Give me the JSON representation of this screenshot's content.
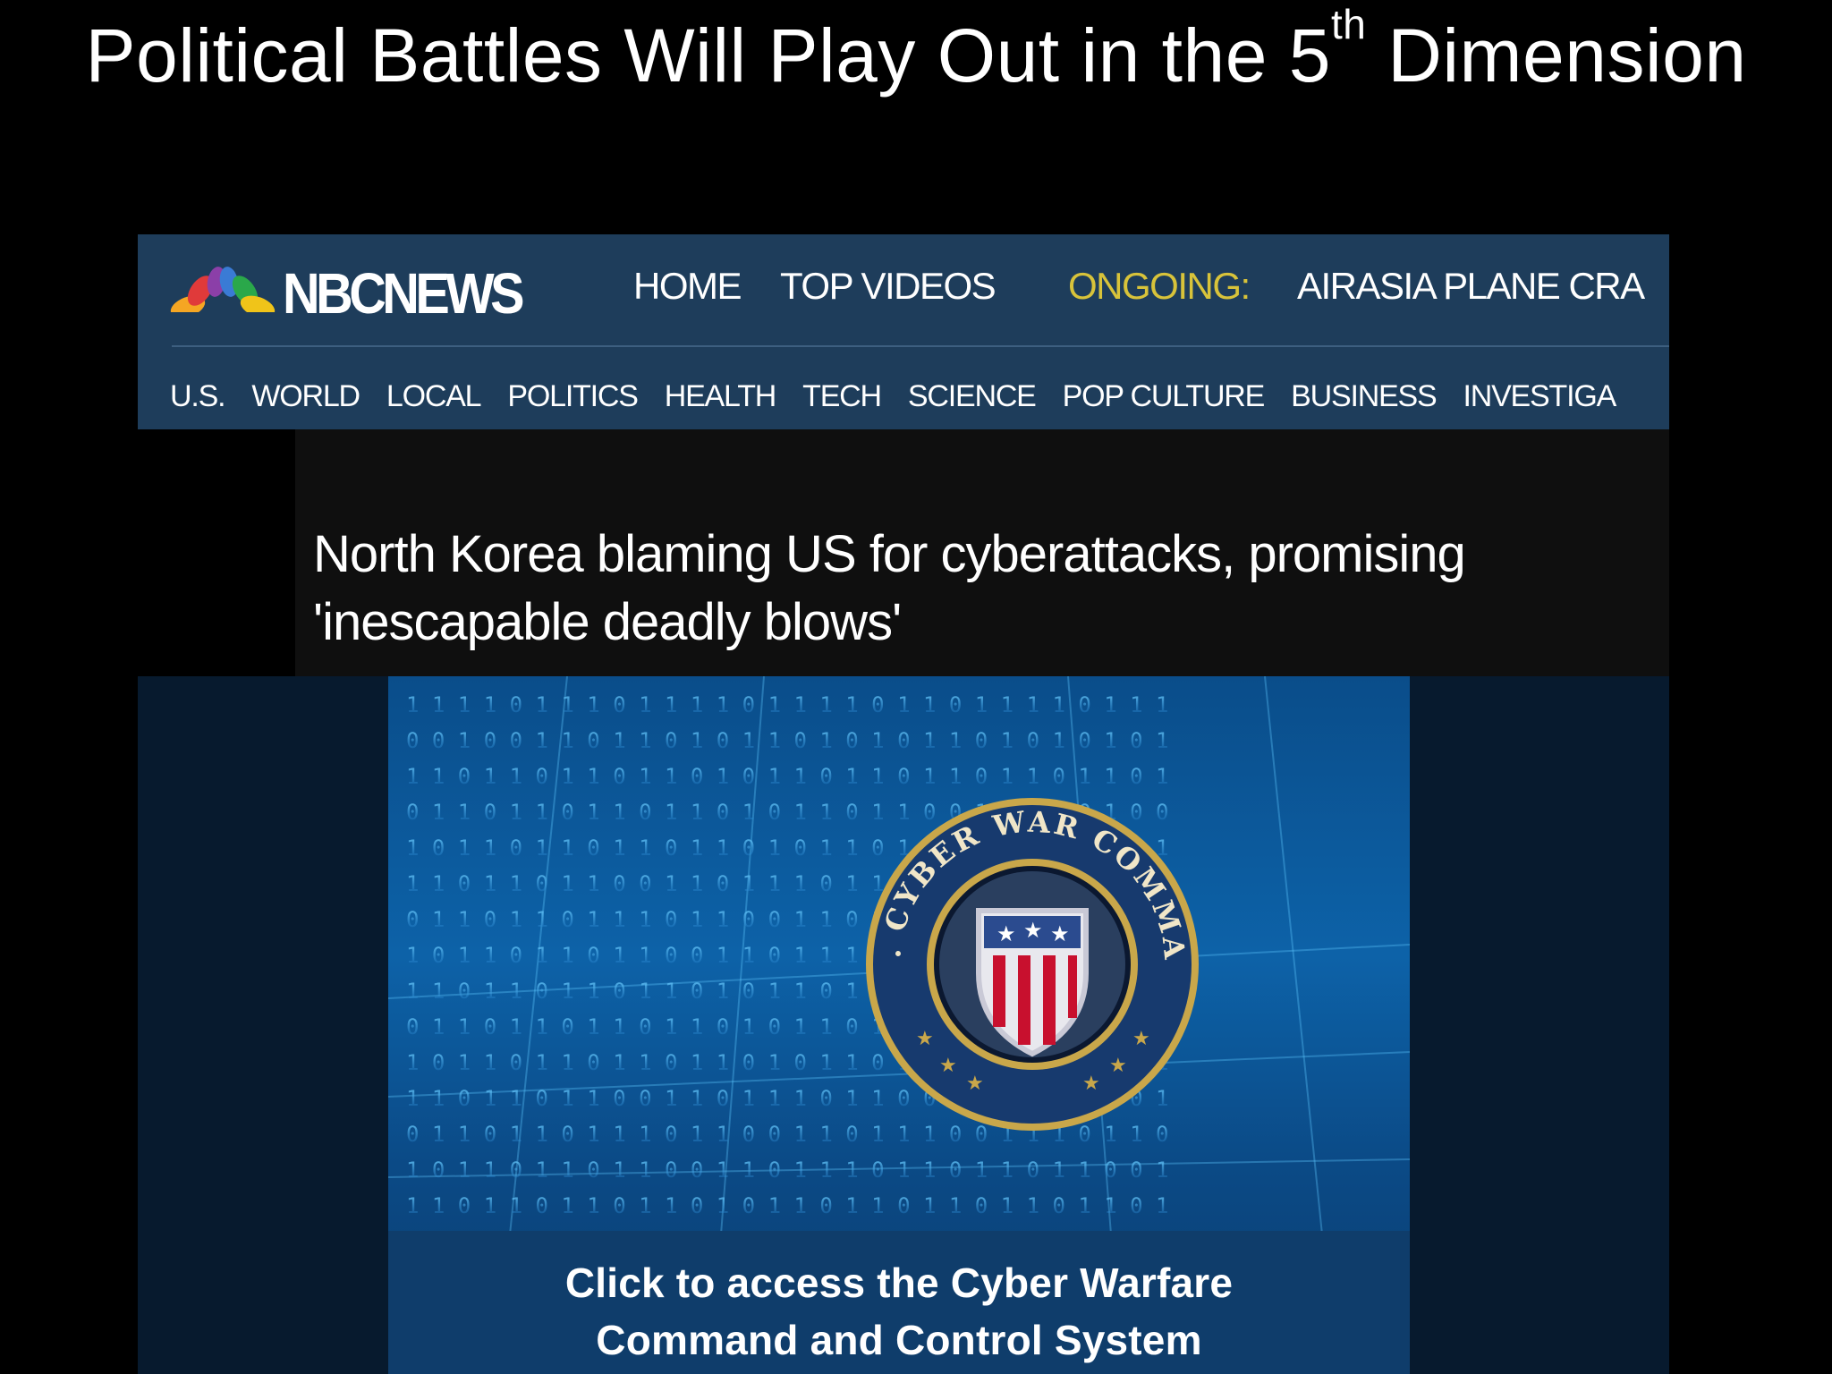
{
  "slide": {
    "title_main": "Political Battles Will Play Out in the 5",
    "title_sup": "th",
    "title_end": " Dimension"
  },
  "nav": {
    "logo_text": "NBCNEWS",
    "home": "HOME",
    "top_videos": "TOP VIDEOS",
    "ongoing_label": "ONGOING:",
    "ongoing_story": "AIRASIA PLANE CRA",
    "sections": [
      "U.S.",
      "WORLD",
      "LOCAL",
      "POLITICS",
      "HEALTH",
      "TECH",
      "SCIENCE",
      "POP CULTURE",
      "BUSINESS",
      "INVESTIGA"
    ]
  },
  "article": {
    "headline": "North Korea blaming US for cyberattacks, promising 'inescapable deadly blows'"
  },
  "video": {
    "emblem_text_top": "U.S. CYBER WAR COMMAND",
    "caption_line1": "Click to access the Cyber Warfare",
    "caption_line2": "Command and Control System"
  },
  "colors": {
    "nav_bg": "#1e3d5b",
    "ongoing": "#d8c33a",
    "video_blue": "#0d62a8"
  }
}
